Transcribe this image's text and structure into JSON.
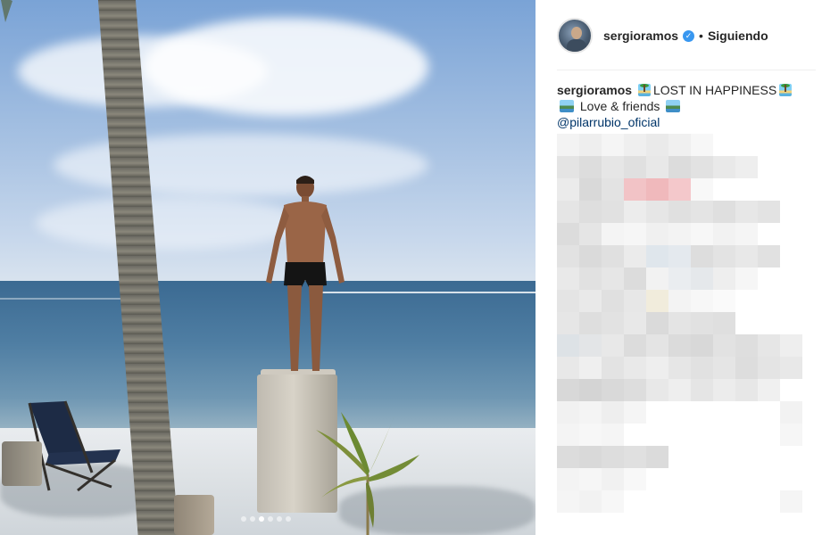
{
  "photo": {
    "carousel": {
      "count": 6,
      "active_index": 2
    }
  },
  "post": {
    "header": {
      "username": "sergioramos",
      "verified_symbol": "✓",
      "separator": "•",
      "follow_status": "Siguiendo"
    },
    "caption": {
      "username": "sergioramos",
      "line1_text": "LOST IN HAPPINESS",
      "line2_text": "Love & friends",
      "mention": "@pilarrubio_oficial",
      "icons": [
        "desert-island-emoji",
        "national-park-emoji"
      ]
    },
    "comments_pixelated": true
  },
  "colors": {
    "link": "#003569",
    "verified": "#3897f0",
    "text": "#262626",
    "divider": "#efefef"
  }
}
